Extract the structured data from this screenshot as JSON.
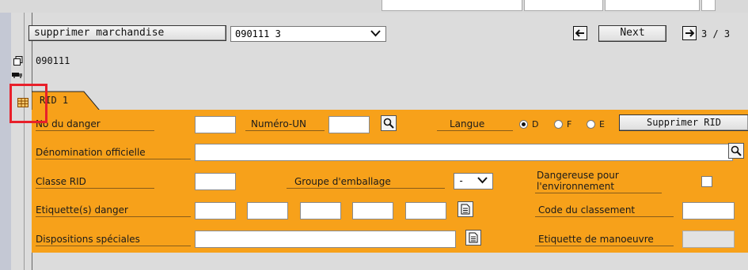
{
  "toolbar": {
    "action_label": "supprimer marchandise",
    "item_select_value": "090111 3",
    "next_label": "Next",
    "page_indicator": "3 / 3"
  },
  "record": {
    "id": "090111"
  },
  "tab": {
    "label": "RID 1"
  },
  "form": {
    "no_danger_label": "No du danger",
    "numero_un_label": "Numéro-UN",
    "langue_label": "Langue",
    "langue_options": [
      "D",
      "F",
      "E"
    ],
    "langue_selected": "D",
    "supprimer_rid_label": "Supprimer RID",
    "denomination_label": "Dénomination officielle",
    "classe_label": "Classe RID",
    "groupe_label": "Groupe d'emballage",
    "groupe_value": "-",
    "dangereuse_label": "Dangereuse pour l'environnement",
    "etiquettes_label": "Etiquette(s) danger",
    "code_label": "Code du classement",
    "dispositions_label": "Dispositions spéciales",
    "etiquette_manoeuvre_label": "Etiquette de manoeuvre"
  },
  "colors": {
    "panel": "#f7a11a",
    "highlight": "#e8202a"
  }
}
